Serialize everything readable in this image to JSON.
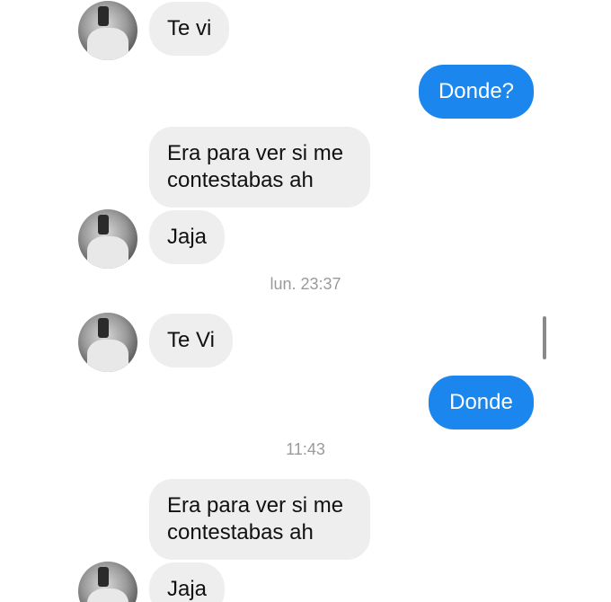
{
  "messages": [
    {
      "text": "Te vi"
    },
    {
      "text": "Donde?"
    },
    {
      "text": "Era para ver si me contestabas ah"
    },
    {
      "text": "Jaja"
    },
    {
      "text": "Te Vi"
    },
    {
      "text": "Donde"
    },
    {
      "text": "Era para ver si me contestabas ah"
    },
    {
      "text": "Jaja"
    }
  ],
  "timestamps": [
    "lun. 23:37",
    "11:43"
  ],
  "colors": {
    "outgoing_bubble": "#1a86ee",
    "incoming_bubble": "#eeeeee"
  }
}
